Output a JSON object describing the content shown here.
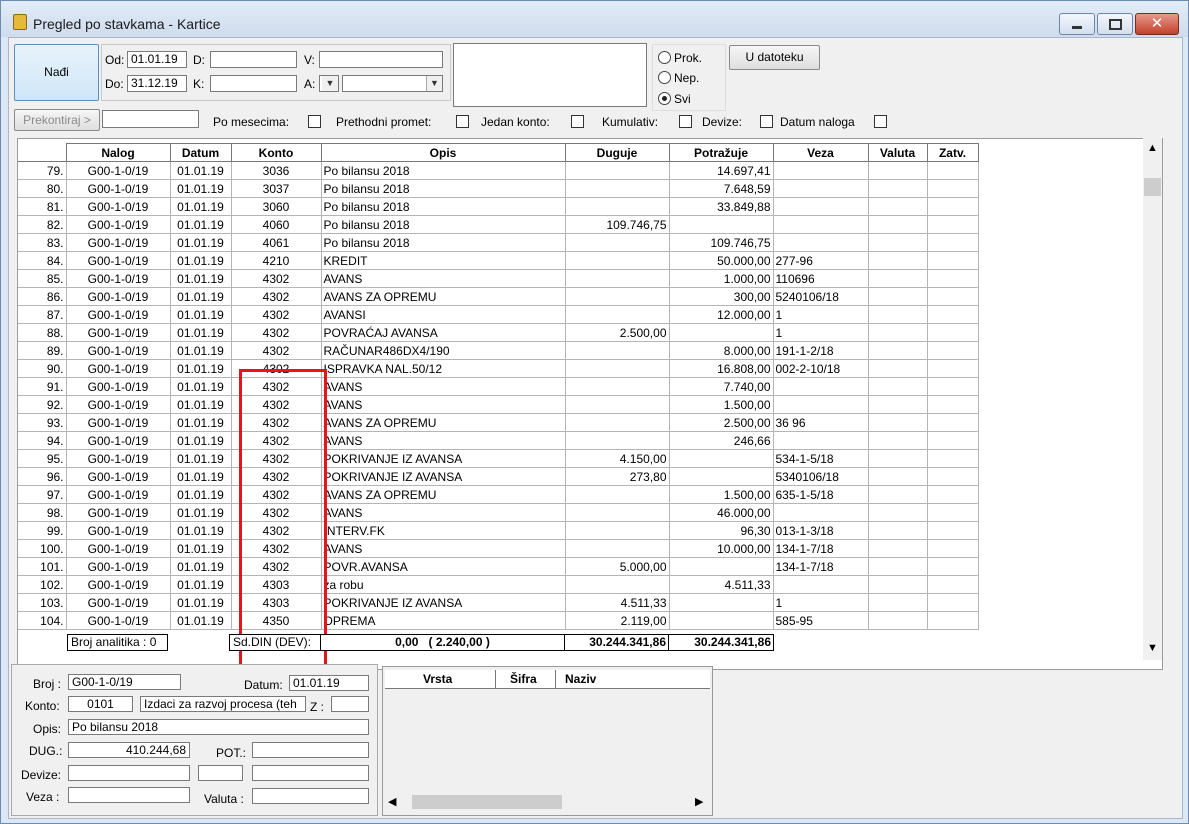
{
  "window": {
    "title": "Pregled po stavkama - Kartice"
  },
  "header": {
    "find_button": "Nađi",
    "od_label": "Od:",
    "od_value": "01.01.19",
    "do_label": "Do:",
    "do_value": "31.12.19",
    "d_label": "D:",
    "k_label": "K:",
    "v_label": "V:",
    "a_label": "A:",
    "radio_prok": "Prok.",
    "radio_nep": "Nep.",
    "radio_svi": "Svi",
    "export_button": "U datoteku",
    "prekontiraj_button": "Prekontiraj >",
    "opt_po_mesecima": "Po mesecima:",
    "opt_prethodni": "Prethodni promet:",
    "opt_jedan_konto": "Jedan konto:",
    "opt_kumulativ": "Kumulativ:",
    "opt_devize": "Devize:",
    "opt_datum_naloga": "Datum naloga"
  },
  "grid": {
    "columns": [
      "Nalog",
      "Datum",
      "Konto",
      "Opis",
      "Duguje",
      "Potražuje",
      "Veza",
      "Valuta",
      "Zatv."
    ],
    "rows": [
      [
        "79.",
        "G00-1-0/19",
        "01.01.19",
        "3036",
        "Po bilansu 2018",
        "",
        "14.697,41",
        ""
      ],
      [
        "80.",
        "G00-1-0/19",
        "01.01.19",
        "3037",
        "Po bilansu 2018",
        "",
        "7.648,59",
        ""
      ],
      [
        "81.",
        "G00-1-0/19",
        "01.01.19",
        "3060",
        "Po bilansu 2018",
        "",
        "33.849,88",
        ""
      ],
      [
        "82.",
        "G00-1-0/19",
        "01.01.19",
        "4060",
        "Po bilansu 2018",
        "109.746,75",
        "",
        ""
      ],
      [
        "83.",
        "G00-1-0/19",
        "01.01.19",
        "4061",
        "Po bilansu 2018",
        "",
        "109.746,75",
        ""
      ],
      [
        "84.",
        "G00-1-0/19",
        "01.01.19",
        "4210",
        "KREDIT",
        "",
        "50.000,00",
        "277-96"
      ],
      [
        "85.",
        "G00-1-0/19",
        "01.01.19",
        "4302",
        "AVANS",
        "",
        "1.000,00",
        "110696"
      ],
      [
        "86.",
        "G00-1-0/19",
        "01.01.19",
        "4302",
        "AVANS ZA OPREMU",
        "",
        "300,00",
        "5240106/18"
      ],
      [
        "87.",
        "G00-1-0/19",
        "01.01.19",
        "4302",
        "AVANSI",
        "",
        "12.000,00",
        "1"
      ],
      [
        "88.",
        "G00-1-0/19",
        "01.01.19",
        "4302",
        "POVRAĆAJ AVANSA",
        "2.500,00",
        "",
        "1"
      ],
      [
        "89.",
        "G00-1-0/19",
        "01.01.19",
        "4302",
        "RAČUNAR486DX4/190",
        "",
        "8.000,00",
        "191-1-2/18"
      ],
      [
        "90.",
        "G00-1-0/19",
        "01.01.19",
        "4302",
        "ISPRAVKA NAL.50/12",
        "",
        "16.808,00",
        "002-2-10/18"
      ],
      [
        "91.",
        "G00-1-0/19",
        "01.01.19",
        "4302",
        "AVANS",
        "",
        "7.740,00",
        ""
      ],
      [
        "92.",
        "G00-1-0/19",
        "01.01.19",
        "4302",
        "AVANS",
        "",
        "1.500,00",
        ""
      ],
      [
        "93.",
        "G00-1-0/19",
        "01.01.19",
        "4302",
        "AVANS ZA OPREMU",
        "",
        "2.500,00",
        "36 96"
      ],
      [
        "94.",
        "G00-1-0/19",
        "01.01.19",
        "4302",
        "AVANS",
        "",
        "246,66",
        ""
      ],
      [
        "95.",
        "G00-1-0/19",
        "01.01.19",
        "4302",
        "POKRIVANJE IZ AVANSA",
        "4.150,00",
        "",
        "534-1-5/18"
      ],
      [
        "96.",
        "G00-1-0/19",
        "01.01.19",
        "4302",
        "POKRIVANJE IZ AVANSA",
        "273,80",
        "",
        "5340106/18"
      ],
      [
        "97.",
        "G00-1-0/19",
        "01.01.19",
        "4302",
        "AVANS ZA OPREMU",
        "",
        "1.500,00",
        "635-1-5/18"
      ],
      [
        "98.",
        "G00-1-0/19",
        "01.01.19",
        "4302",
        "AVANS",
        "",
        "46.000,00",
        ""
      ],
      [
        "99.",
        "G00-1-0/19",
        "01.01.19",
        "4302",
        "INTERV.FK",
        "",
        "96,30",
        "013-1-3/18"
      ],
      [
        "100.",
        "G00-1-0/19",
        "01.01.19",
        "4302",
        "AVANS",
        "",
        "10.000,00",
        "134-1-7/18"
      ],
      [
        "101.",
        "G00-1-0/19",
        "01.01.19",
        "4302",
        "POVR.AVANSA",
        "5.000,00",
        "",
        "134-1-7/18"
      ],
      [
        "102.",
        "G00-1-0/19",
        "01.01.19",
        "4303",
        "za robu",
        "",
        "4.511,33",
        ""
      ],
      [
        "103.",
        "G00-1-0/19",
        "01.01.19",
        "4303",
        "POKRIVANJE IZ AVANSA",
        "4.511,33",
        "",
        "1"
      ],
      [
        "104.",
        "G00-1-0/19",
        "01.01.19",
        "4350",
        "OPREMA",
        "2.119,00",
        "",
        "585-95"
      ]
    ]
  },
  "footer": {
    "broj_analitika": "Broj analitika : 0",
    "saldo_label": "Sd.DIN (DEV):",
    "saldo_value": "0,00   ( 2.240,00 )",
    "total_duguje": "30.244.341,86",
    "total_potrazuje": "30.244.341,86"
  },
  "detail": {
    "broj_label": "Broj :",
    "broj_value": "G00-1-0/19",
    "datum_label": "Datum:",
    "datum_value": "01.01.19",
    "konto_label": "Konto:",
    "konto_value": "0101",
    "konto_name": "Izdaci za razvoj procesa (teh",
    "z_label": "Z :",
    "opis_label": "Opis:",
    "opis_value": "Po bilansu 2018",
    "dug_label": "DUG.:",
    "dug_value": "410.244,68",
    "pot_label": "POT.:",
    "devize_label": "Devize:",
    "veza_label": "Veza :",
    "valuta_label": "Valuta :"
  },
  "subgrid": {
    "columns": [
      "Vrsta",
      "Šifra",
      "Naziv"
    ]
  }
}
